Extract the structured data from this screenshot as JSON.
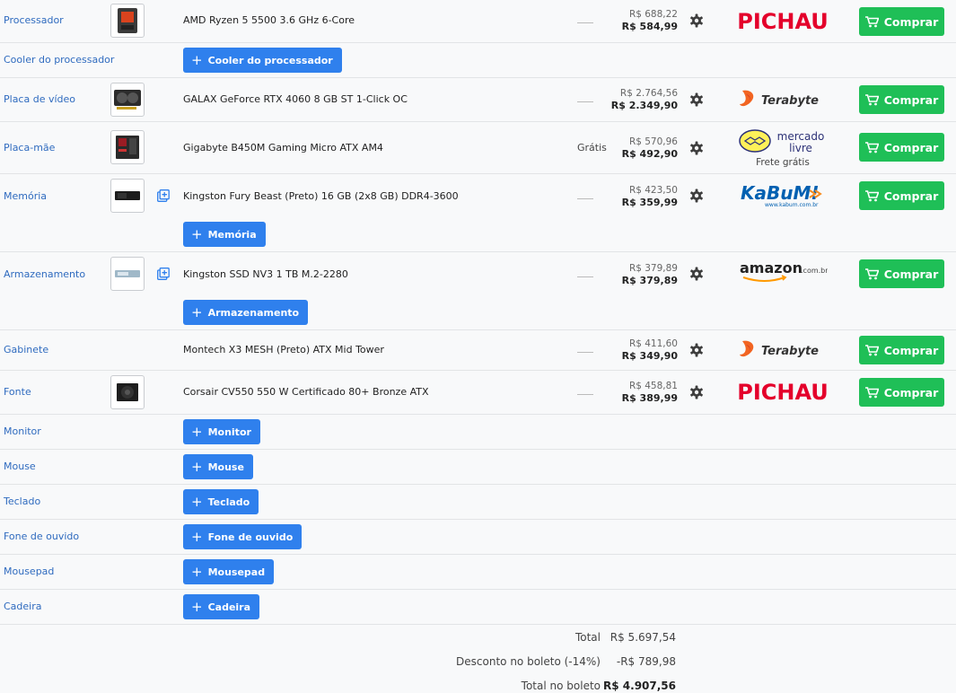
{
  "buy_label": "Comprar",
  "rows": [
    {
      "category": "Processador",
      "name": "AMD Ryzen 5 5500 3.6 GHz 6-Core",
      "shipping": "",
      "price_old": "R$ 688,22",
      "price_new": "R$ 584,99",
      "store": "Pichau"
    },
    {
      "category": "Cooler do processador",
      "add_label": "Cooler do processador"
    },
    {
      "category": "Placa de vídeo",
      "name": "GALAX GeForce RTX 4060 8 GB ST 1-Click OC",
      "shipping": "",
      "price_old": "R$ 2.764,56",
      "price_new": "R$ 2.349,90",
      "store": "Terabyte"
    },
    {
      "category": "Placa-mãe",
      "name": "Gigabyte B450M Gaming Micro ATX AM4",
      "shipping": "Grátis",
      "price_old": "R$ 570,96",
      "price_new": "R$ 492,90",
      "store": "Mercado Livre",
      "store_note": "Frete grátis"
    },
    {
      "category": "Memória",
      "name": "Kingston Fury Beast (Preto) 16 GB (2x8 GB) DDR4-3600",
      "shipping": "",
      "price_old": "R$ 423,50",
      "price_new": "R$ 359,99",
      "store": "KaBuM!",
      "add_label": "Memória"
    },
    {
      "category": "Armazenamento",
      "name": "Kingston SSD NV3 1 TB M.2-2280",
      "shipping": "",
      "price_old": "R$ 379,89",
      "price_new": "R$ 379,89",
      "store": "Amazon",
      "add_label": "Armazenamento"
    },
    {
      "category": "Gabinete",
      "name": "Montech X3 MESH (Preto) ATX Mid Tower",
      "shipping": "",
      "price_old": "R$ 411,60",
      "price_new": "R$ 349,90",
      "store": "Terabyte"
    },
    {
      "category": "Fonte",
      "name": "Corsair CV550 550 W Certificado 80+ Bronze ATX",
      "shipping": "",
      "price_old": "R$ 458,81",
      "price_new": "R$ 389,99",
      "store": "Pichau"
    },
    {
      "category": "Monitor",
      "add_label": "Monitor"
    },
    {
      "category": "Mouse",
      "add_label": "Mouse"
    },
    {
      "category": "Teclado",
      "add_label": "Teclado"
    },
    {
      "category": "Fone de ouvido",
      "add_label": "Fone de ouvido"
    },
    {
      "category": "Mousepad",
      "add_label": "Mousepad"
    },
    {
      "category": "Cadeira",
      "add_label": "Cadeira"
    }
  ],
  "store_logos": {
    "pichau": "PICHAU",
    "terabyte": "Terabyte",
    "mercadolivre_line1": "mercado",
    "mercadolivre_line2": "livre",
    "kabum": "KaBuM!",
    "kabum_sub": "www.kabum.com.br",
    "amazon": "amazon",
    "amazon_tld": ".com.br"
  },
  "totals": {
    "total_label": "Total",
    "total_value": "R$ 5.697,54",
    "discount_label": "Desconto no boleto (-14%)",
    "discount_value": "-R$ 789,98",
    "boleto_label": "Total no boleto",
    "boleto_value": "R$ 4.907,56"
  },
  "colors": {
    "link": "#2f6bbf",
    "add_button": "#2f80ed",
    "buy_button": "#1fbf57",
    "pichau": "#e4002b",
    "terabyte": "#f26522",
    "kabum": "#0060b1",
    "amazon_smile": "#ff9900"
  }
}
